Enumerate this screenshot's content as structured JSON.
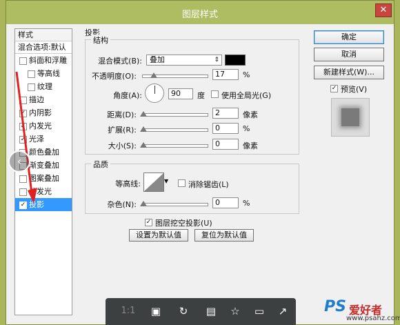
{
  "window": {
    "title": "图层样式",
    "close_glyph": "✕"
  },
  "styles_panel": {
    "header": "样式",
    "blend_options": "混合选项:默认",
    "items": [
      {
        "label": "斜面和浮雕",
        "checked": false,
        "indent": false,
        "selected": false
      },
      {
        "label": "等高线",
        "checked": false,
        "indent": true,
        "selected": false
      },
      {
        "label": "纹理",
        "checked": false,
        "indent": true,
        "selected": false
      },
      {
        "label": "描边",
        "checked": false,
        "indent": false,
        "selected": false
      },
      {
        "label": "内阴影",
        "checked": true,
        "indent": false,
        "selected": false
      },
      {
        "label": "内发光",
        "checked": true,
        "indent": false,
        "selected": false
      },
      {
        "label": "光泽",
        "checked": true,
        "indent": false,
        "selected": false
      },
      {
        "label": "颜色叠加",
        "checked": false,
        "indent": false,
        "selected": false
      },
      {
        "label": "渐变叠加",
        "checked": false,
        "indent": false,
        "selected": false
      },
      {
        "label": "图案叠加",
        "checked": false,
        "indent": false,
        "selected": false
      },
      {
        "label": "外发光",
        "checked": false,
        "indent": false,
        "selected": false
      },
      {
        "label": "投影",
        "checked": true,
        "indent": false,
        "selected": true
      }
    ]
  },
  "drop_shadow": {
    "section_title": "投影",
    "structure": {
      "title": "结构",
      "blend_mode_label": "混合模式(B):",
      "blend_mode_value": "叠加",
      "blend_color": "#000000",
      "opacity_label": "不透明度(O):",
      "opacity_value": "17",
      "opacity_unit": "%",
      "opacity_fraction": 0.17,
      "angle_label": "角度(A):",
      "angle_value": "90",
      "angle_unit": "度",
      "global_light_label": "使用全局光(G)",
      "global_light_checked": false,
      "distance_label": "距离(D):",
      "distance_value": "2",
      "distance_unit": "像素",
      "spread_label": "扩展(R):",
      "spread_value": "0",
      "spread_unit": "%",
      "size_label": "大小(S):",
      "size_value": "0",
      "size_unit": "像素"
    },
    "quality": {
      "title": "品质",
      "contour_label": "等高线:",
      "anti_alias_label": "消除锯齿(L)",
      "anti_alias_checked": false,
      "noise_label": "杂色(N):",
      "noise_value": "0",
      "noise_unit": "%"
    },
    "knockout_label": "图层挖空投影(U)",
    "knockout_checked": true,
    "make_default": "设置为默认值",
    "reset_default": "复位为默认值"
  },
  "buttons": {
    "ok": "确定",
    "cancel": "取消",
    "new_style": "新建样式(W)...",
    "preview_label": "预览(V)",
    "preview_checked": true
  },
  "viewer_toolbar": {
    "zoom_text": "1:1",
    "icons": [
      "fit-screen-icon",
      "rotate-icon",
      "save-icon",
      "favorite-icon",
      "slideshow-icon",
      "share-icon"
    ]
  },
  "watermark": {
    "brand": "PS",
    "cn": "爱好者",
    "url": "www.psahz.com"
  },
  "colors": {
    "titlebar": "#aebc62",
    "selection": "#3399ff",
    "annotation_arrow": "#e02020"
  }
}
